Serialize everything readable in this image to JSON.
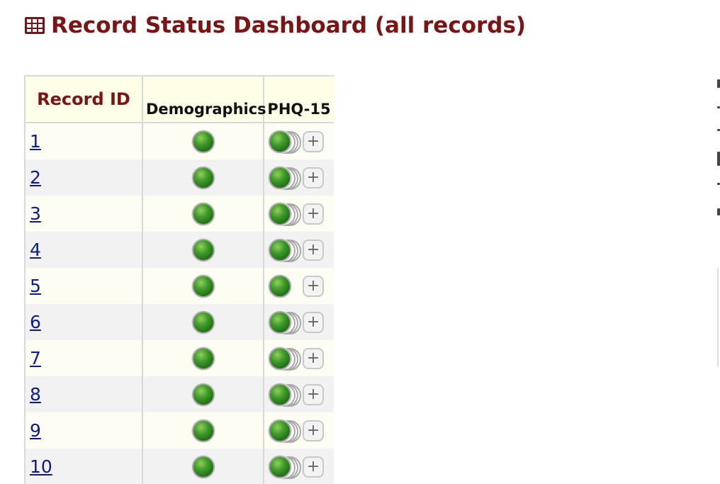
{
  "page": {
    "title": "Record Status Dashboard (all records)",
    "title_color": "#7b1414",
    "title_icon": "table-grid-icon"
  },
  "table": {
    "headers": {
      "record_id": "Record ID",
      "demographics": "Demographics",
      "phq15": "PHQ-15"
    },
    "header_bg": "#fffee6",
    "status_color": "#3f9a2a",
    "link_color": "#0b1a8c",
    "add_button_label": "+",
    "rows": [
      {
        "id": "1",
        "demographics_status": "complete",
        "phq15_status": "complete",
        "phq15_multiple_instances": true
      },
      {
        "id": "2",
        "demographics_status": "complete",
        "phq15_status": "complete",
        "phq15_multiple_instances": true
      },
      {
        "id": "3",
        "demographics_status": "complete",
        "phq15_status": "complete",
        "phq15_multiple_instances": true
      },
      {
        "id": "4",
        "demographics_status": "complete",
        "phq15_status": "complete",
        "phq15_multiple_instances": true
      },
      {
        "id": "5",
        "demographics_status": "complete",
        "phq15_status": "complete",
        "phq15_multiple_instances": false
      },
      {
        "id": "6",
        "demographics_status": "complete",
        "phq15_status": "complete",
        "phq15_multiple_instances": true
      },
      {
        "id": "7",
        "demographics_status": "complete",
        "phq15_status": "complete",
        "phq15_multiple_instances": true
      },
      {
        "id": "8",
        "demographics_status": "complete",
        "phq15_status": "complete",
        "phq15_multiple_instances": true
      },
      {
        "id": "9",
        "demographics_status": "complete",
        "phq15_status": "complete",
        "phq15_multiple_instances": true
      },
      {
        "id": "10",
        "demographics_status": "complete",
        "phq15_status": "complete",
        "phq15_multiple_instances": true
      }
    ]
  }
}
